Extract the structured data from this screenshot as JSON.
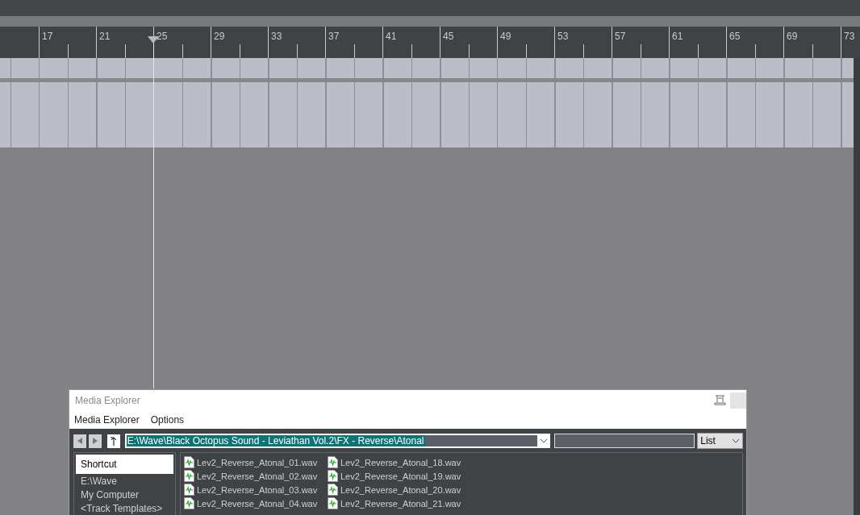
{
  "ruler": {
    "bars": [
      "17",
      "21",
      "25",
      "29",
      "33",
      "37",
      "41",
      "45",
      "49",
      "53",
      "57",
      "61",
      "65",
      "69",
      "73"
    ]
  },
  "media_explorer": {
    "title": "Media Explorer",
    "menu": [
      "Media Explorer",
      "Options"
    ],
    "path": {
      "value": "E:\\Wave\\Black Octopus Sound - Leviathan Vol.2\\FX - Reverse\\Atonal",
      "selected": true
    },
    "view_select": "List",
    "sidebar": [
      {
        "label": "Shortcut",
        "selected": true
      },
      {
        "label": "E:\\Wave",
        "selected": false
      },
      {
        "label": "My Computer",
        "selected": false
      },
      {
        "label": "<Track Templates>",
        "selected": false
      }
    ],
    "files": [
      "Lev2_Reverse_Atonal_01.wav",
      "Lev2_Reverse_Atonal_02.wav",
      "Lev2_Reverse_Atonal_03.wav",
      "Lev2_Reverse_Atonal_04.wav",
      "Lev2_Reverse_Atonal_18.wav",
      "Lev2_Reverse_Atonal_19.wav",
      "Lev2_Reverse_Atonal_20.wav",
      "Lev2_Reverse_Atonal_21.wav"
    ]
  }
}
